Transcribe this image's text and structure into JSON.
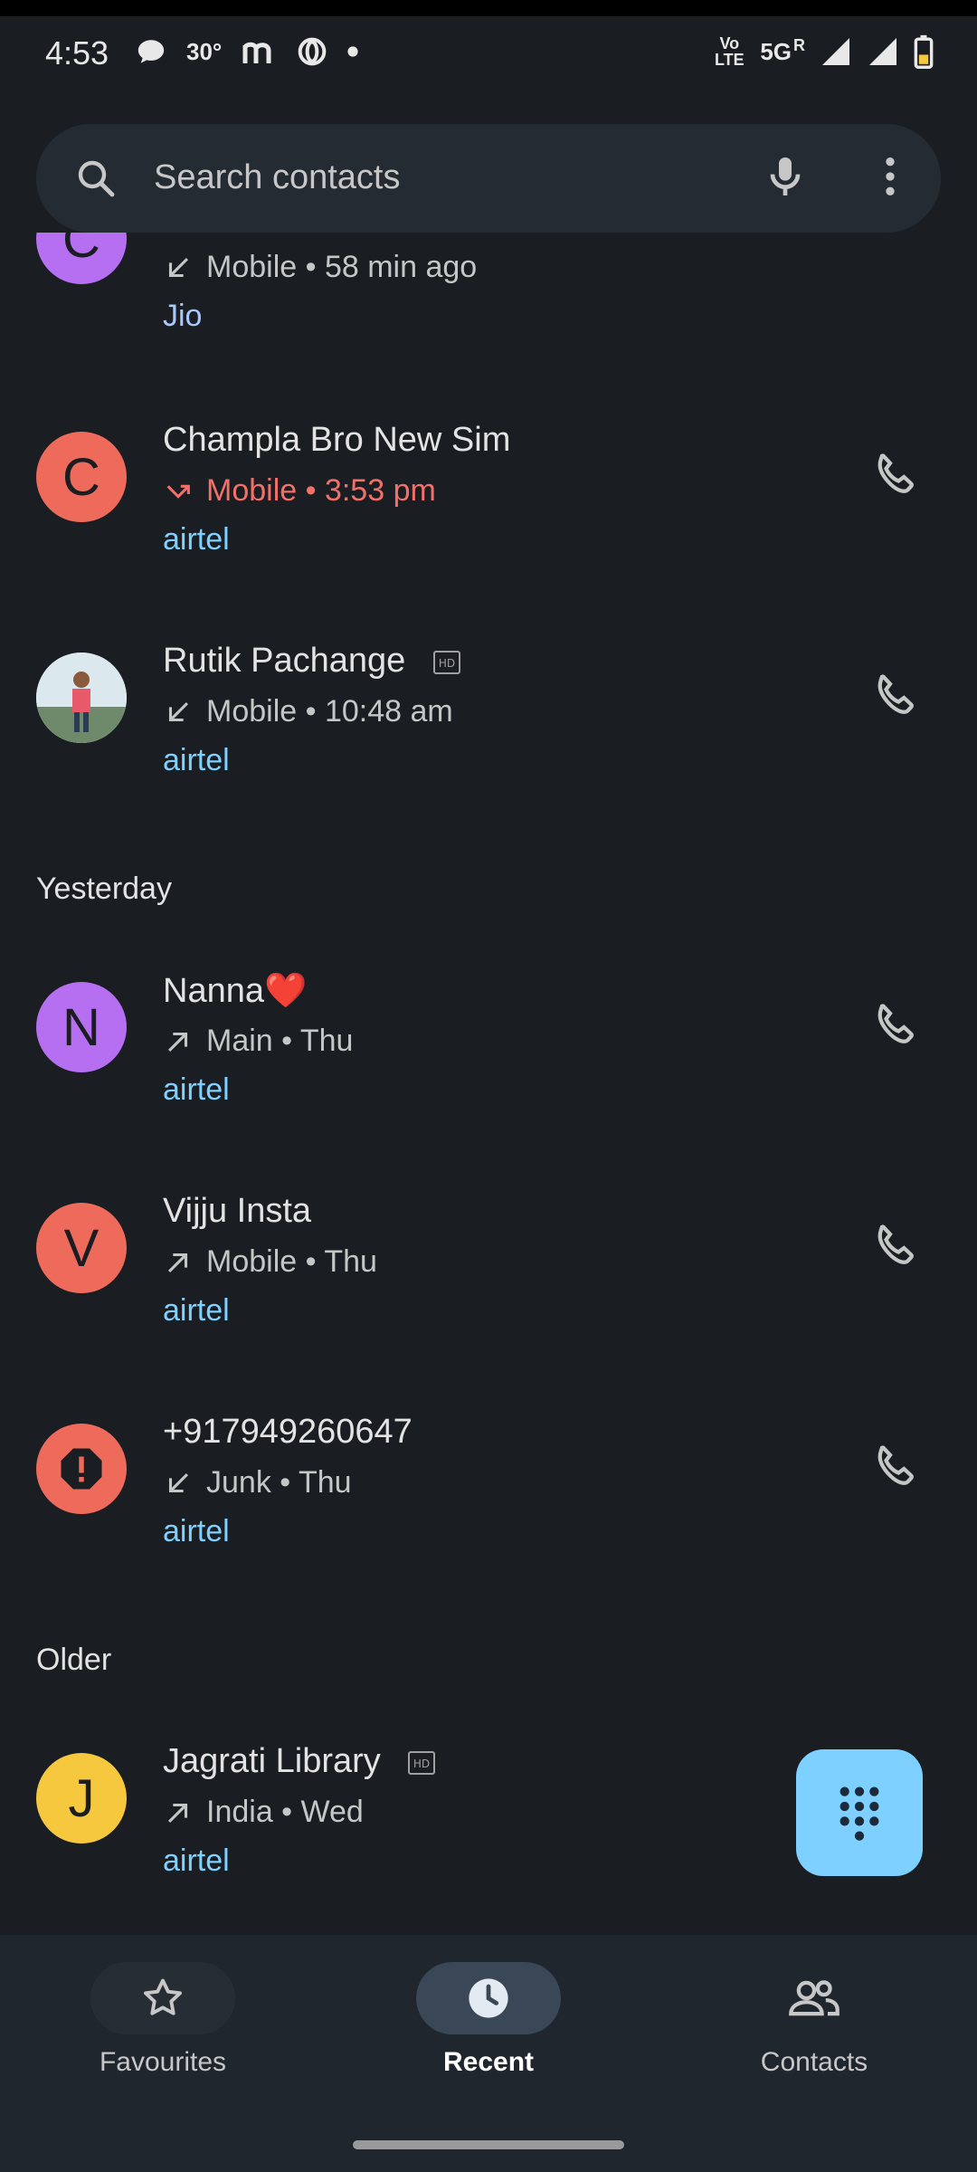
{
  "status": {
    "time": "4:53",
    "temp": "30°",
    "network": "5G",
    "roaming": "R",
    "volte": "Vo LTE"
  },
  "search": {
    "placeholder": "Search contacts"
  },
  "calls": [
    {
      "name": "",
      "detail": "Mobile • 58 min ago",
      "direction": "incoming",
      "carrier": "Jio",
      "avatar_letter": "C",
      "avatar_color": "#b76ff2"
    },
    {
      "name": "Champla Bro New Sim",
      "detail": "Mobile • 3:53 pm",
      "direction": "missed",
      "carrier": "airtel",
      "avatar_letter": "C",
      "avatar_color": "#ee6b5c"
    },
    {
      "name": "Rutik Pachange",
      "detail": "Mobile • 10:48 am",
      "direction": "incoming",
      "carrier": "airtel",
      "avatar_type": "photo",
      "hd": true
    },
    {
      "name": "Nanna❤️",
      "detail": "Main • Thu",
      "direction": "outgoing",
      "carrier": "airtel",
      "avatar_letter": "N",
      "avatar_color": "#b76ff2"
    },
    {
      "name": "Vijju Insta",
      "detail": "Mobile • Thu",
      "direction": "outgoing",
      "carrier": "airtel",
      "avatar_letter": "V",
      "avatar_color": "#ee6b5c"
    },
    {
      "name": "+917949260647",
      "detail": "Junk • Thu",
      "direction": "incoming",
      "carrier": "airtel",
      "avatar_type": "spam",
      "avatar_color": "#ee6b5c"
    },
    {
      "name": "Jagrati Library",
      "detail": "India • Wed",
      "direction": "outgoing",
      "carrier": "airtel",
      "avatar_letter": "J",
      "avatar_color": "#f6c83e",
      "hd": true
    }
  ],
  "sections": {
    "yesterday": "Yesterday",
    "older": "Older"
  },
  "nav": {
    "favourites": "Favourites",
    "recent": "Recent",
    "contacts": "Contacts",
    "active": "recent"
  },
  "colors": {
    "background": "#1a1d21",
    "accent": "#7dd0ff",
    "missed": "#f2706a",
    "carrier": "#7fcfff"
  },
  "icons": {
    "search": "search-icon",
    "mic": "mic-icon",
    "more": "more-vert-icon",
    "call": "phone-icon",
    "dialpad": "dialpad-icon"
  }
}
